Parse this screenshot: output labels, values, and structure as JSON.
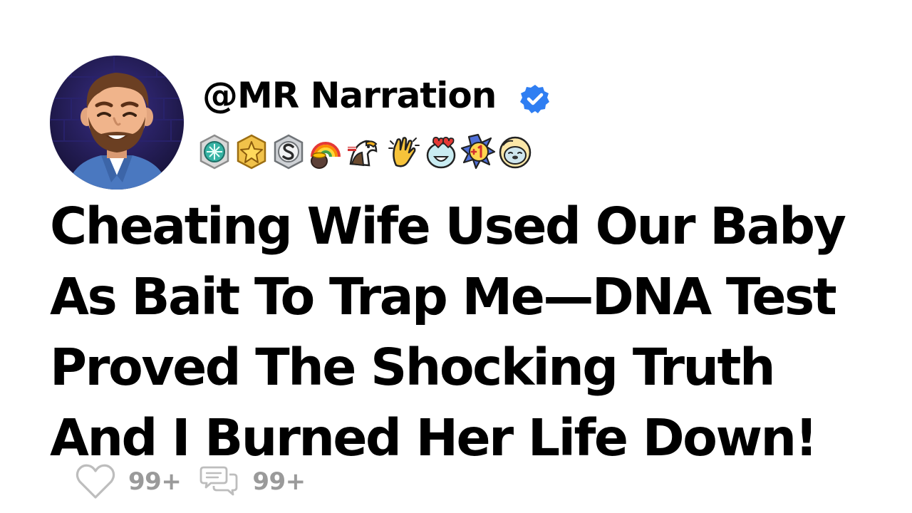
{
  "post": {
    "author_handle": "@MR Narration",
    "verified": true,
    "headline": "Cheating Wife Used Our Baby As Bait To Trap Me—DNA Test Proved The Shocking Truth And I Burned Her Life Down!",
    "likes_count": "99+",
    "comments_count": "99+"
  },
  "badges": [
    {
      "name": "cyan-medal"
    },
    {
      "name": "gold-star-medal"
    },
    {
      "name": "silver-s-medal"
    },
    {
      "name": "rainbow-pot-of-gold"
    },
    {
      "name": "bald-eagle"
    },
    {
      "name": "clapping-hands"
    },
    {
      "name": "heart-eyes-face"
    },
    {
      "name": "plus-one"
    },
    {
      "name": "sleeping-seal"
    }
  ],
  "colors": {
    "text": "#000000",
    "muted": "#9a9a9a",
    "verified_blue": "#2f7ef2"
  }
}
